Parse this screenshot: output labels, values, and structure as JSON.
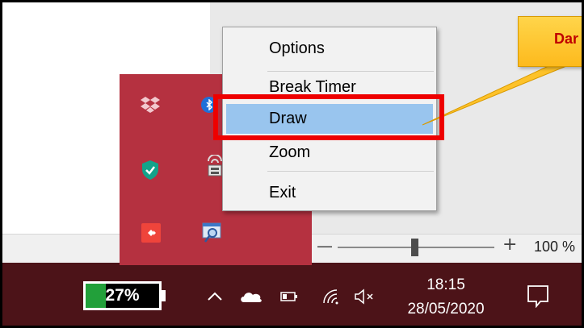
{
  "context_menu": {
    "items": [
      {
        "label": "Options",
        "highlighted": false
      },
      {
        "label": "Break Timer",
        "highlighted": false
      },
      {
        "label": "Draw",
        "highlighted": true
      },
      {
        "label": "Zoom",
        "highlighted": false
      },
      {
        "label": "Exit",
        "highlighted": false
      }
    ]
  },
  "callout": {
    "text": "Dar"
  },
  "status_bar": {
    "zoom_minus": "—",
    "zoom_plus": "+",
    "zoom_level": "100 %"
  },
  "taskbar": {
    "battery": {
      "text": "27%",
      "level": 0.27
    },
    "clock": {
      "time": "18:15",
      "date": "28/05/2020"
    },
    "tray_icons": [
      "chevron-up-icon",
      "onedrive-cloud-icon",
      "battery-icon",
      "wifi-icon",
      "volume-muted-icon",
      "notification-icon"
    ]
  },
  "tray_flyout": {
    "icons": [
      "dropbox-icon",
      "bluetooth-icon",
      "security-shield-icon",
      "network-lock-icon",
      "anydesk-icon",
      "magnifier-icon"
    ]
  },
  "colors": {
    "taskbar": "#4c1318",
    "tray_flyout": "#b53140",
    "menu_highlight": "#99c5ee",
    "highlight_box": "#ee0000",
    "callout": "#fdba1d",
    "battery_fill": "#22a03a"
  }
}
